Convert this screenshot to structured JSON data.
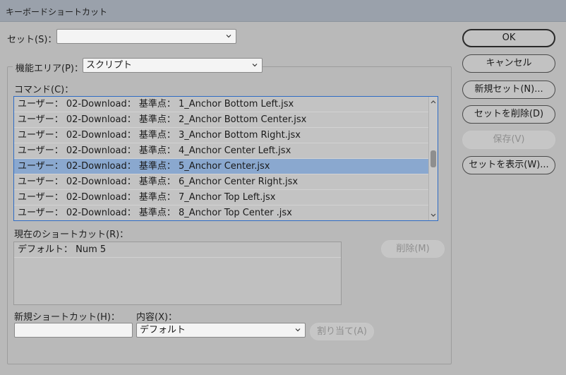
{
  "window": {
    "title": "キーボードショートカット"
  },
  "set": {
    "label": "セット(S)：",
    "value": ""
  },
  "product_area": {
    "label": "機能エリア(P)：",
    "value": "スクリプト"
  },
  "commands": {
    "label": "コマンド(C)：",
    "items": [
      "ユーザー：  02-Download： 基準点：  1_Anchor Bottom Left.jsx",
      "ユーザー：  02-Download： 基準点：  2_Anchor Bottom Center.jsx",
      "ユーザー：  02-Download： 基準点：  3_Anchor Bottom Right.jsx",
      "ユーザー：  02-Download： 基準点：  4_Anchor Center Left.jsx",
      "ユーザー：  02-Download： 基準点：  5_Anchor Center.jsx",
      "ユーザー：  02-Download： 基準点：  6_Anchor Center Right.jsx",
      "ユーザー：  02-Download： 基準点：  7_Anchor Top Left.jsx",
      "ユーザー：  02-Download： 基準点：  8_Anchor Top Center .jsx"
    ],
    "selected_index": 4
  },
  "current_shortcuts": {
    "label": "現在のショートカット(R)：",
    "items": [
      "デフォルト： Num 5"
    ],
    "remove_label": "削除(M)"
  },
  "new_shortcut": {
    "label": "新規ショートカット(H)：",
    "value": ""
  },
  "context": {
    "label": "内容(X)：",
    "value": "デフォルト"
  },
  "assign_label": "割り当て(A)",
  "buttons": {
    "ok": "OK",
    "cancel": "キャンセル",
    "new_set": "新規セット(N)...",
    "delete_set": "セットを削除(D)",
    "save": "保存(V)",
    "show_set": "セットを表示(W)..."
  }
}
